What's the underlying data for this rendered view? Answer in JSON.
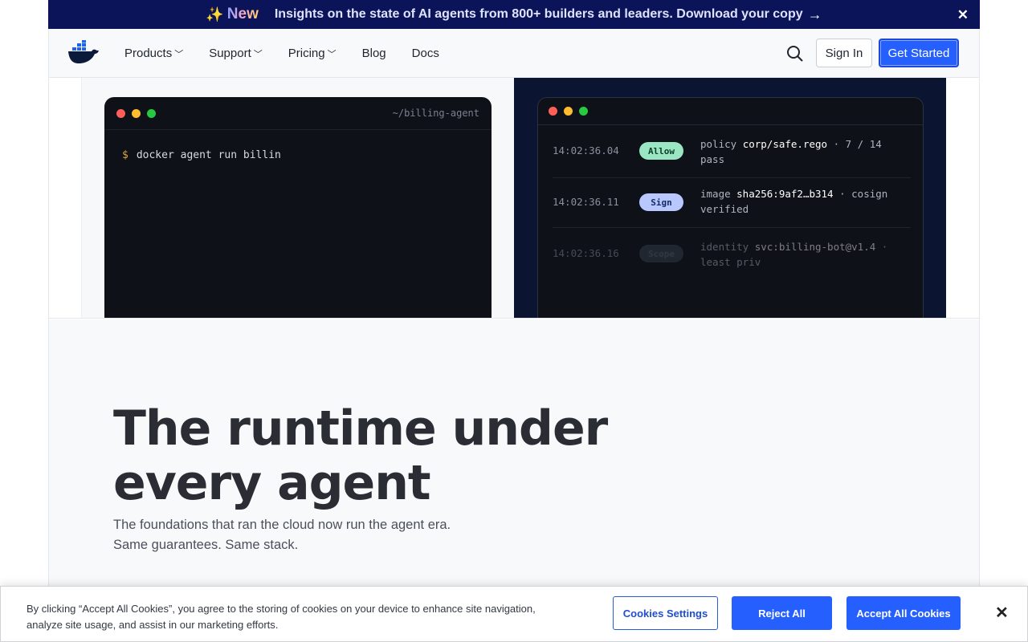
{
  "banner": {
    "new_label": "New",
    "message": "Insights on the state of AI agents from 800+ builders and leaders. Download your copy",
    "arrow": "→",
    "close": "✕"
  },
  "nav": {
    "items": [
      {
        "label": "Products",
        "dropdown": true
      },
      {
        "label": "Support",
        "dropdown": true
      },
      {
        "label": "Pricing",
        "dropdown": true
      },
      {
        "label": "Blog",
        "dropdown": false
      },
      {
        "label": "Docs",
        "dropdown": false
      }
    ],
    "sign_in": "Sign In",
    "get_started": "Get Started"
  },
  "terminal_left": {
    "path": "~/billing-agent",
    "prompt": "$",
    "command": "docker agent run billin"
  },
  "terminal_right": {
    "rows": [
      {
        "time": "14:02:36.04",
        "badge": "Allow",
        "desc_pre": "policy ",
        "desc_hl": "corp/safe.rego",
        "desc_post": " · 7 / 14 pass"
      },
      {
        "time": "14:02:36.11",
        "badge": "Sign",
        "desc_pre": "image ",
        "desc_hl": "sha256:9af2…b314",
        "desc_post": " · cosign verified"
      },
      {
        "time": "14:02:36.16",
        "badge": "Scope",
        "desc_pre": "identity ",
        "desc_hl": "svc:billing-bot@v1.4",
        "desc_post": " · least priv"
      }
    ]
  },
  "main": {
    "headline_line1": "The runtime under",
    "headline_line2": "every agent",
    "subline_line1": "The foundations that ran the cloud now run the agent era.",
    "subline_line2": "Same guarantees. Same stack."
  },
  "cookie": {
    "text": "By clicking “Accept All Cookies”, you agree to the storing of cookies on your device to enhance site navigation, analyze site usage, and assist in our marketing efforts.",
    "settings": "Cookies Settings",
    "reject": "Reject All",
    "accept": "Accept All Cookies",
    "close": "✕"
  },
  "colors": {
    "banner_bg": "#0b1459",
    "primary": "#2560ff",
    "terminal_bg": "#0e1117",
    "headline": "#2a2d33"
  }
}
